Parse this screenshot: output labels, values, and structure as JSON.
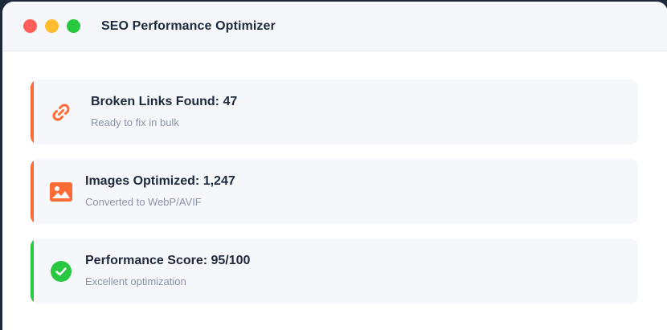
{
  "window": {
    "title": "SEO Performance Optimizer"
  },
  "cards": [
    {
      "heading": "Broken Links Found: 47",
      "subtitle": "Ready to fix in bulk",
      "icon": "link-icon",
      "accent_color": "#ff6b35"
    },
    {
      "heading": "Images Optimized: 1,247",
      "subtitle": "Converted to WebP/AVIF",
      "icon": "image-icon",
      "accent_color": "#ff6b35"
    },
    {
      "heading": "Performance Score: 95/100",
      "subtitle": "Excellent optimization",
      "icon": "check-circle-icon",
      "accent_color": "#28c840"
    }
  ]
}
